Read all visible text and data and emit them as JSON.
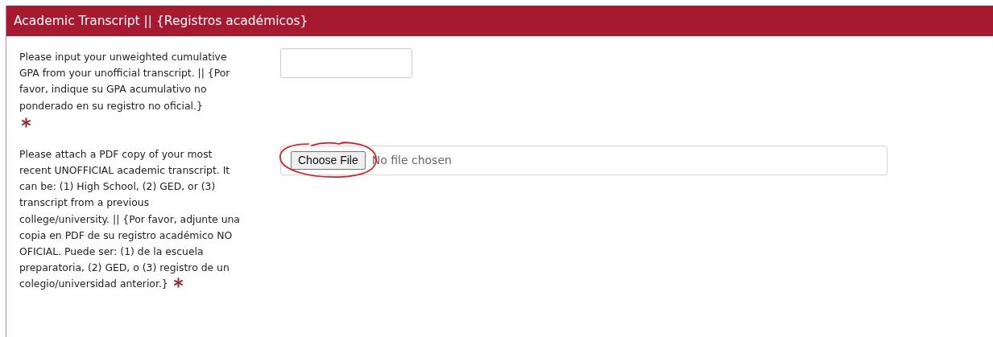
{
  "panel": {
    "title": "Academic Transcript || {Registros académicos}"
  },
  "questions": [
    {
      "kind": "text",
      "label": "Please input your unweighted cumulative GPA from your unofficial transcript. || {Por favor, indique su GPA acumulativo no ponderado en su registro no oficial.}",
      "required": true
    },
    {
      "kind": "file",
      "label": "Please attach a PDF copy of your most recent UNOFFICIAL academic transcript. It can be: (1) High School, (2) GED, or (3) transcript from a previous college/university. || {Por favor, adjunte una copia en PDF de su registro académico NO OFICIAL. Puede ser: (1) de la escuela preparatoria, (2) GED, o (3) registro de un colegio/universidad anterior.}",
      "required": true,
      "button_label": "Choose File",
      "status": "No file chosen",
      "annotated": true
    }
  ]
}
